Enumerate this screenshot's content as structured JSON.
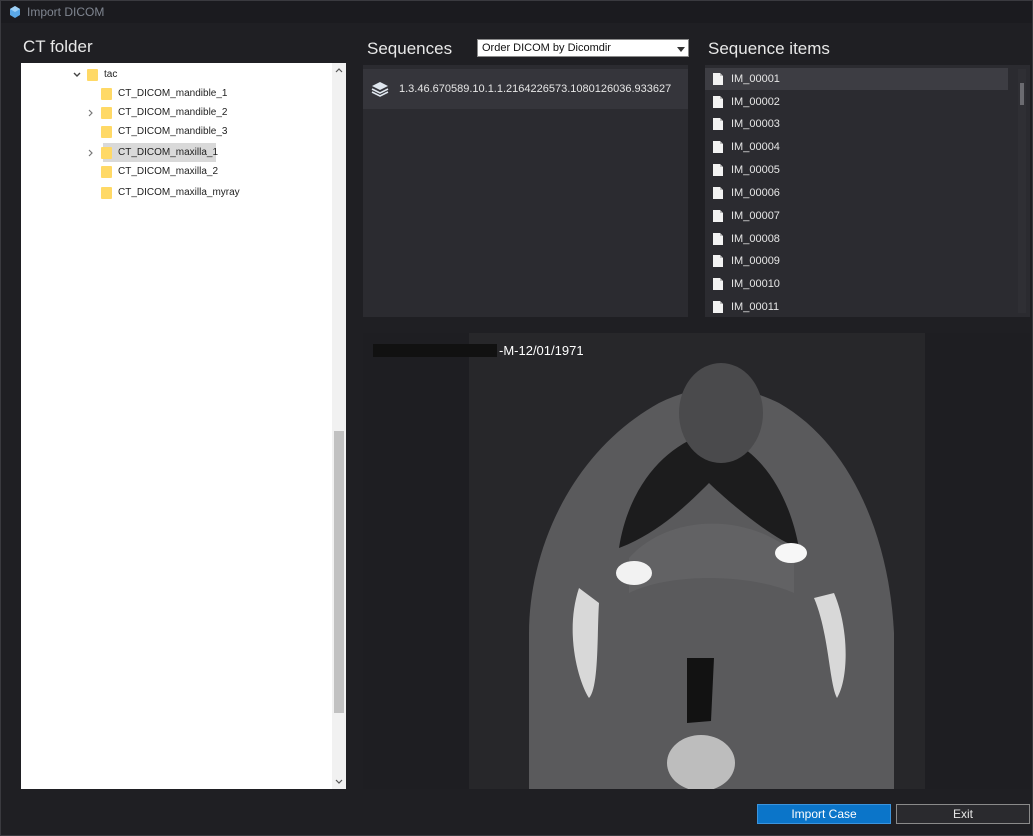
{
  "window": {
    "title": "Import DICOM"
  },
  "labels": {
    "ct_folder": "CT folder",
    "sequences": "Sequences",
    "sequence_items": "Sequence items"
  },
  "tree": {
    "items": [
      {
        "label": "tac",
        "expanded": true
      },
      {
        "label": "CT_DICOM_mandible_1"
      },
      {
        "label": "CT_DICOM_mandible_2",
        "collapsed": true
      },
      {
        "label": "CT_DICOM_mandible_3"
      },
      {
        "label": "CT_DICOM_maxilla_1",
        "collapsed": true,
        "selected": true
      },
      {
        "label": "CT_DICOM_maxilla_2"
      },
      {
        "label": "CT_DICOM_maxilla_myray"
      }
    ]
  },
  "sequences": {
    "order_select": "Order DICOM by Dicomdir",
    "items": [
      {
        "uid": "1.3.46.670589.10.1.1.2164226573.1080126036.933627"
      }
    ]
  },
  "sequence_items": [
    "IM_00001",
    "IM_00002",
    "IM_00003",
    "IM_00004",
    "IM_00005",
    "IM_00006",
    "IM_00007",
    "IM_00008",
    "IM_00009",
    "IM_00010",
    "IM_00011"
  ],
  "viewer": {
    "patient_info": "-M-12/01/1971"
  },
  "buttons": {
    "import": "Import Case",
    "exit": "Exit"
  },
  "colors": {
    "accent": "#0b75c9",
    "folder": "#ffd966",
    "panel": "#2b2b30"
  }
}
